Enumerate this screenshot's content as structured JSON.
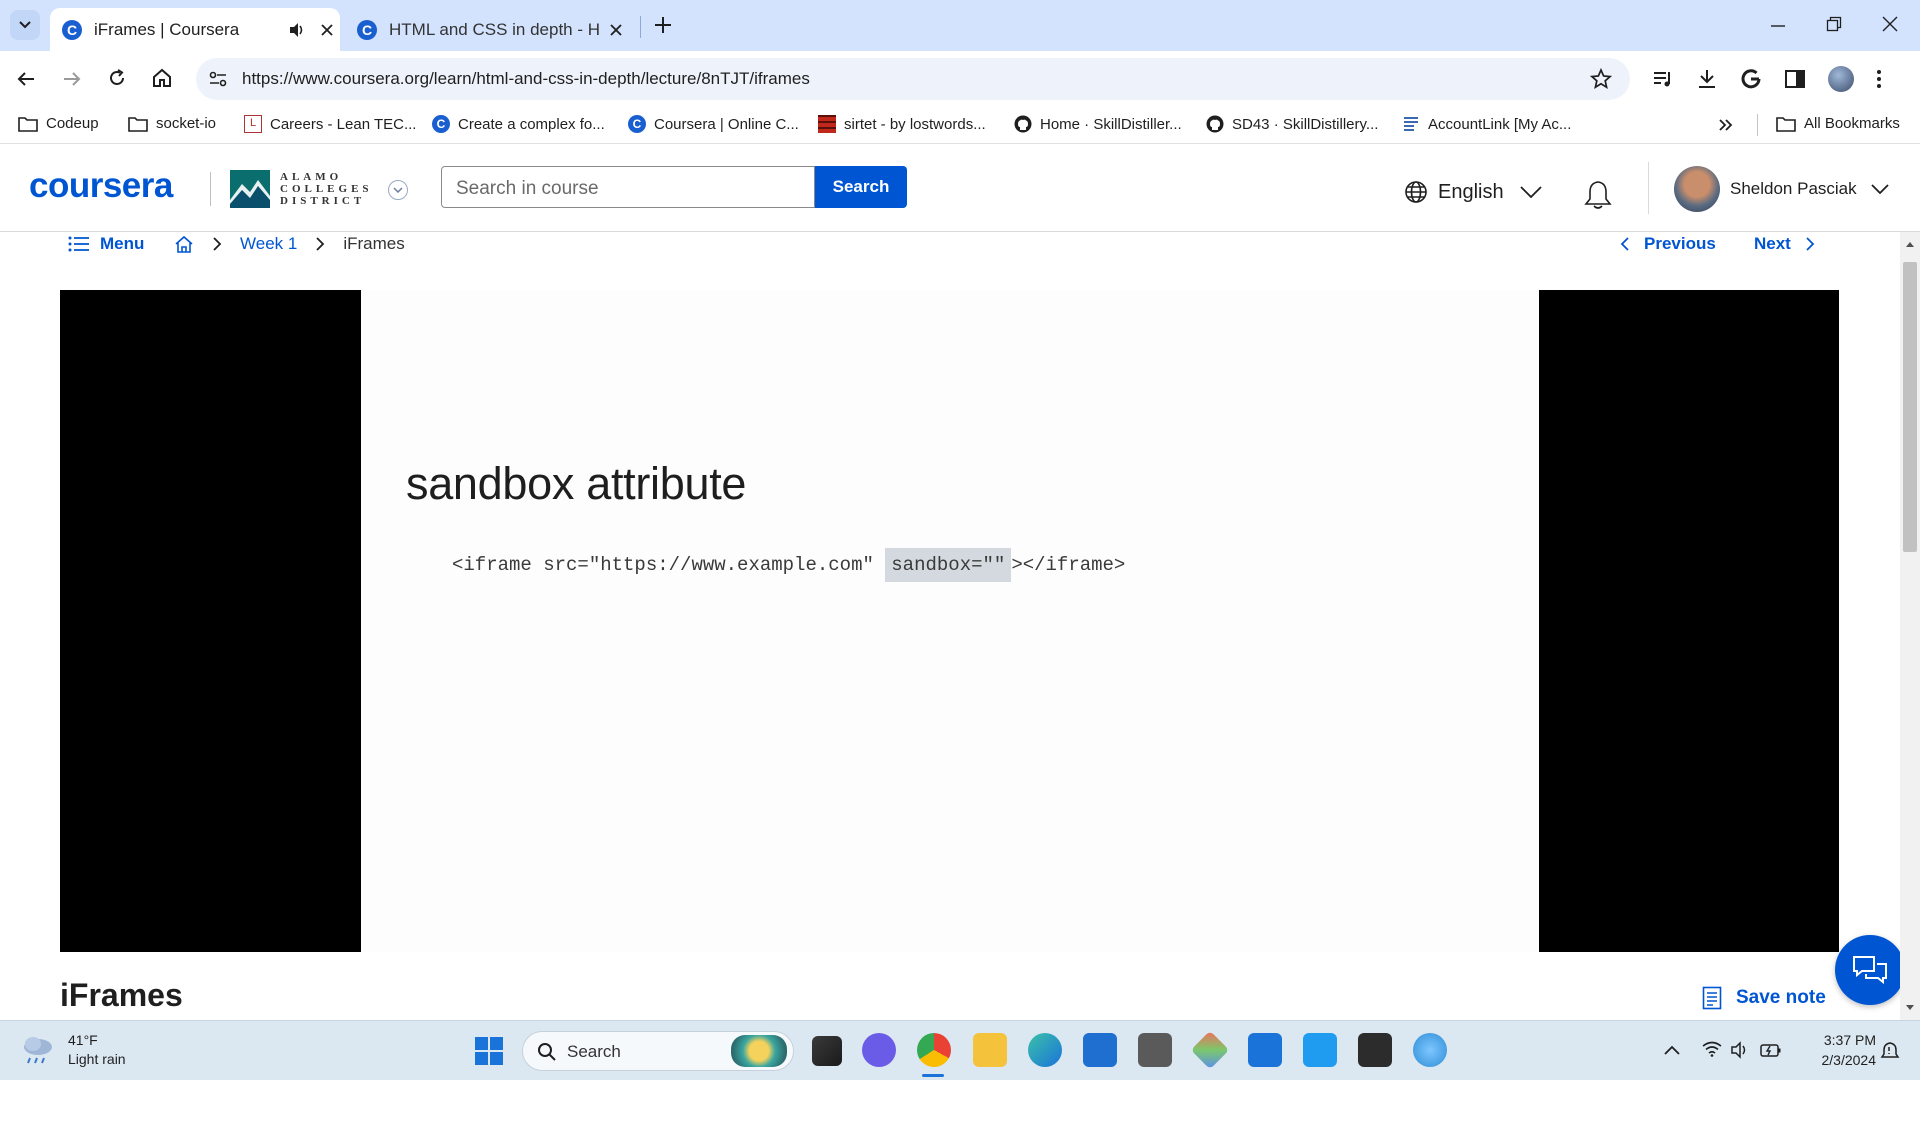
{
  "browser": {
    "tabs": [
      {
        "title": "iFrames | Coursera",
        "active": true
      },
      {
        "title": "HTML and CSS in depth - HTML",
        "active": false
      }
    ],
    "url": "https://www.coursera.org/learn/html-and-css-in-depth/lecture/8nTJT/iframes",
    "bookmarks": [
      "Codeup",
      "socket-io",
      "Careers - Lean TEC...",
      "Create a complex fo...",
      "Coursera | Online C...",
      "sirtet - by lostwords...",
      "Home · SkillDistiller...",
      "SD43 · SkillDistillery...",
      "AccountLink [My Ac..."
    ],
    "all_bookmarks": "All Bookmarks"
  },
  "header": {
    "logo": "coursera",
    "partner_logo": [
      "ALAMO",
      "COLLEGES",
      "DISTRICT"
    ],
    "search_placeholder": "Search in course",
    "search_button": "Search",
    "language": "English",
    "user_name": "Sheldon Pasciak"
  },
  "nav": {
    "menu": "Menu",
    "breadcrumb_week": "Week 1",
    "breadcrumb_current": "iFrames",
    "previous": "Previous",
    "next": "Next"
  },
  "slide": {
    "title": "sandbox attribute",
    "code_before": "<iframe src=\"https://www.example.com\" ",
    "code_highlight": "sandbox=\"\"",
    "code_after": "></iframe>"
  },
  "lecture": {
    "title": "iFrames",
    "save_note": "Save note"
  },
  "taskbar": {
    "temperature": "41°F",
    "weather": "Light rain",
    "search_label": "Search",
    "time": "3:37 PM",
    "date": "2/3/2024"
  },
  "colors": {
    "coursera_blue": "#0056d2",
    "tabstrip": "#d3e3fd",
    "taskbar": "#dbe8f2"
  }
}
